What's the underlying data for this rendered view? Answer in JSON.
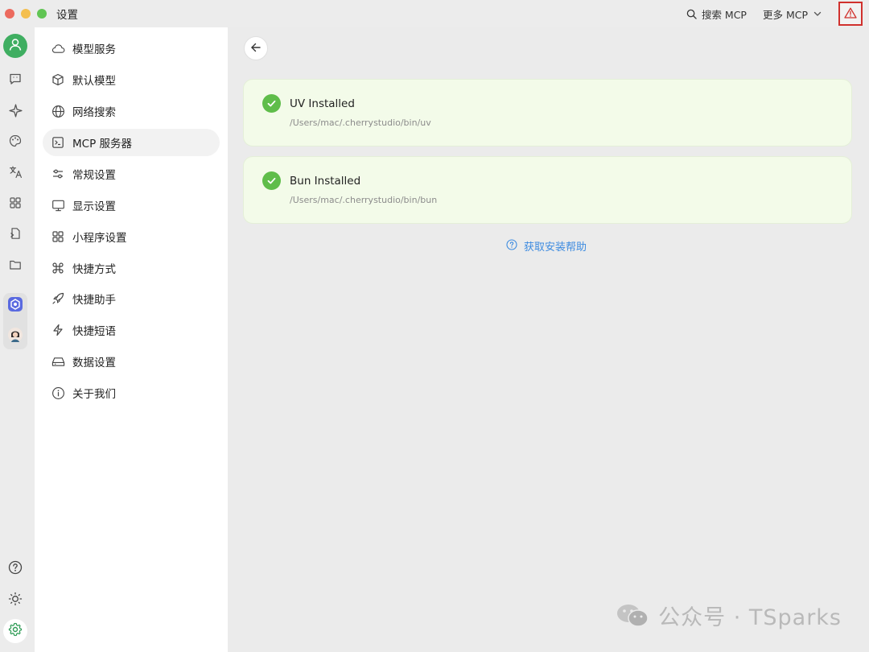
{
  "window": {
    "title": "设置"
  },
  "titlebar": {
    "search_mcp_label": "搜索 MCP",
    "more_mcp_label": "更多 MCP",
    "warning_icon": "warning-triangle-icon",
    "warning_color": "#d0312d"
  },
  "rail": {
    "items": [
      {
        "name": "avatar",
        "icon": "user-icon"
      },
      {
        "name": "assistants",
        "icon": "chat-icon"
      },
      {
        "name": "agents",
        "icon": "sparkle-icon"
      },
      {
        "name": "paintings",
        "icon": "palette-icon"
      },
      {
        "name": "translate",
        "icon": "translate-icon"
      },
      {
        "name": "mini-apps",
        "icon": "grid-icon"
      },
      {
        "name": "files-doc",
        "icon": "document-icon"
      },
      {
        "name": "files",
        "icon": "folder-icon"
      },
      {
        "name": "mini-app-1",
        "icon": "app-logo-icon"
      },
      {
        "name": "mini-app-2",
        "icon": "person-app-icon"
      },
      {
        "name": "help",
        "icon": "help-icon"
      },
      {
        "name": "theme",
        "icon": "sun-icon"
      },
      {
        "name": "settings",
        "icon": "gear-icon"
      }
    ]
  },
  "sidebar": {
    "items": [
      {
        "label": "模型服务",
        "icon": "cloud-icon"
      },
      {
        "label": "默认模型",
        "icon": "cube-icon"
      },
      {
        "label": "网络搜索",
        "icon": "globe-icon"
      },
      {
        "label": "MCP 服务器",
        "icon": "terminal-icon",
        "active": true
      },
      {
        "label": "常规设置",
        "icon": "sliders-icon"
      },
      {
        "label": "显示设置",
        "icon": "monitor-icon"
      },
      {
        "label": "小程序设置",
        "icon": "grid-icon"
      },
      {
        "label": "快捷方式",
        "icon": "command-icon"
      },
      {
        "label": "快捷助手",
        "icon": "rocket-icon"
      },
      {
        "label": "快捷短语",
        "icon": "zap-icon"
      },
      {
        "label": "数据设置",
        "icon": "hard-drive-icon"
      },
      {
        "label": "关于我们",
        "icon": "info-icon"
      }
    ]
  },
  "main": {
    "cards": [
      {
        "title": "UV Installed",
        "path": "/Users/mac/.cherrystudio/bin/uv"
      },
      {
        "title": "Bun Installed",
        "path": "/Users/mac/.cherrystudio/bin/bun"
      }
    ],
    "help_link": "获取安装帮助"
  },
  "watermark": {
    "text": "公众号 · TSparks"
  },
  "colors": {
    "accent_green": "#5fbd4a",
    "card_bg": "#f3fbe9",
    "link_blue": "#3d8be0"
  }
}
